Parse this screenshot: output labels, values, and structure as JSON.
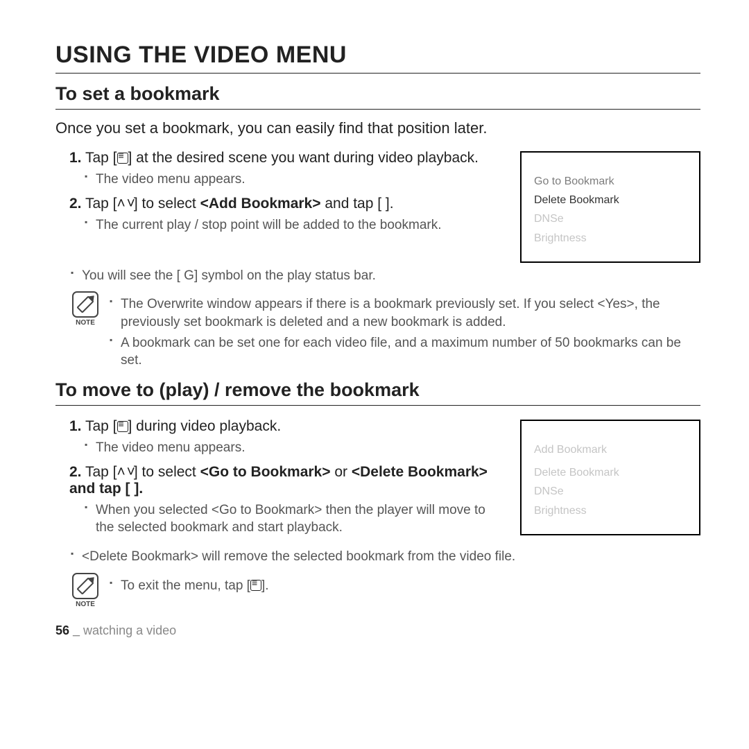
{
  "title": "USING THE VIDEO MENU",
  "section1": {
    "heading": "To set a bookmark",
    "intro": "Once you set a bookmark, you can easily find that position later.",
    "step1_pre": "Tap [",
    "step1_post": "] at the desired scene you want during video playback.",
    "step1_sub1": "The video menu appears.",
    "step2_pre": "Tap [",
    "step2_mid": "] to select ",
    "step2_bold": "<Add Bookmark>",
    "step2_post": " and tap [      ].",
    "step2_sub1": "The current play / stop point will be added to the bookmark.",
    "step2_sub2_pre": "You will see the [ ",
    "step2_sub2_g": "G",
    "step2_sub2_post": "] symbol on the play status bar.",
    "note1_a": "The Overwrite window appears if there is a bookmark previously set. If you select <Yes>, the previously set bookmark is deleted and a new bookmark is added.",
    "note1_b": "A bookmark can be set one for each video file, and a maximum number of 50 bookmarks can be set.",
    "menu": {
      "goto": "Go to Bookmark",
      "delete": "Delete Bookmark",
      "dnse": "DNSe",
      "brightness": "Brightness"
    }
  },
  "section2": {
    "heading": "To move to (play) / remove the bookmark",
    "step1_pre": "Tap [",
    "step1_post": "] during video playback.",
    "step1_sub1": "The video menu appears.",
    "step2_pre": "Tap [",
    "step2_mid": "] to select ",
    "step2_bold1": "<Go to Bookmark>",
    "step2_or": " or ",
    "step2_bold2": "<Delete Bookmark>",
    "step2_post": " and tap [      ].",
    "step2_sub1": "When you selected <Go to Bookmark> then the player will move to the selected bookmark and start playback.",
    "step2_sub2": "<Delete Bookmark> will remove the selected bookmark from the video file.",
    "note2_pre": "To exit the menu, tap [",
    "note2_post": "].",
    "menu": {
      "add": "Add Bookmark",
      "delete": "Delete Bookmark",
      "dnse": "DNSe",
      "brightness": "Brightness"
    }
  },
  "labels": {
    "note": "NOTE",
    "num1": "1.",
    "num2": "2."
  },
  "footer": {
    "page": "56 _",
    "section": " watching a video"
  }
}
